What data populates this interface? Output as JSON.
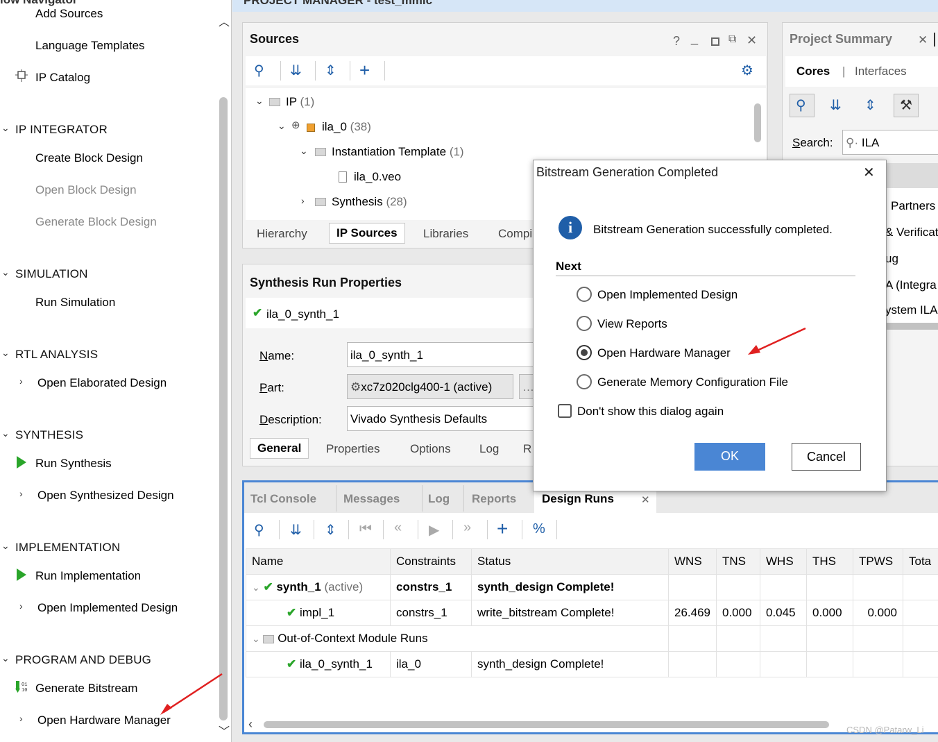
{
  "flow_nav": {
    "top_title": "low Navigator",
    "items_top": [
      "Add Sources",
      "Language Templates",
      "IP Catalog"
    ],
    "ip_integrator": {
      "header": "IP INTEGRATOR",
      "items": [
        "Create Block Design",
        "Open Block Design",
        "Generate Block Design"
      ]
    },
    "simulation": {
      "header": "SIMULATION",
      "items": [
        "Run Simulation"
      ]
    },
    "rtl": {
      "header": "RTL ANALYSIS",
      "items": [
        "Open Elaborated Design"
      ]
    },
    "synthesis": {
      "header": "SYNTHESIS",
      "items": [
        "Run Synthesis",
        "Open Synthesized Design"
      ]
    },
    "implementation": {
      "header": "IMPLEMENTATION",
      "items": [
        "Run Implementation",
        "Open Implemented Design"
      ]
    },
    "program": {
      "header": "PROGRAM AND DEBUG",
      "items": [
        "Generate Bitstream",
        "Open Hardware Manager"
      ]
    }
  },
  "topbar": {
    "title": "PROJECT MANAGER - test_mmlc"
  },
  "sources": {
    "title": "Sources",
    "window_icons": [
      "?",
      "_",
      "□",
      "⧉",
      "✕"
    ],
    "tree": [
      {
        "label": "IP",
        "count": "(1)"
      },
      {
        "label": "ila_0",
        "count": "(38)"
      },
      {
        "label": "Instantiation Template",
        "count": "(1)"
      },
      {
        "label": "ila_0.veo",
        "count": ""
      },
      {
        "label": "Synthesis",
        "count": "(28)"
      }
    ],
    "tabs": [
      "Hierarchy",
      "IP Sources",
      "Libraries",
      "Compi"
    ]
  },
  "synth_props": {
    "title": "Synthesis Run Properties",
    "run_name": "ila_0_synth_1",
    "name_label": "Name:",
    "name_value": "ila_0_synth_1",
    "part_label": "Part:",
    "part_value": "xc7z020clg400-1 (active)",
    "desc_label": "Description:",
    "desc_value": "Vivado Synthesis Defaults",
    "tabs": [
      "General",
      "Properties",
      "Options",
      "Log",
      "R"
    ]
  },
  "project_summary": {
    "title": "Project Summary",
    "tabs": [
      "Cores",
      "Interfaces"
    ],
    "search_label": "Search:",
    "search_value": "ILA",
    "list": [
      "Partners",
      "& Verificat",
      "ug",
      "A (Integra",
      "ystem ILA"
    ]
  },
  "dialog": {
    "title": "Bitstream Generation Completed",
    "message": "Bitstream Generation successfully completed.",
    "next_label": "Next",
    "options": [
      "Open Implemented Design",
      "View Reports",
      "Open Hardware Manager",
      "Generate Memory Configuration File"
    ],
    "selected_option": "Open Hardware Manager",
    "dont_show": "Don't show this dialog again",
    "ok": "OK",
    "cancel": "Cancel"
  },
  "bottom": {
    "tabs": [
      "Tcl Console",
      "Messages",
      "Log",
      "Reports",
      "Design Runs"
    ],
    "columns": [
      "Name",
      "Constraints",
      "Status",
      "WNS",
      "TNS",
      "WHS",
      "THS",
      "TPWS",
      "Tota"
    ],
    "rows": [
      {
        "name": "synth_1",
        "suffix": "(active)",
        "constraints": "constrs_1",
        "status": "synth_design Complete!",
        "wns": "",
        "tns": "",
        "whs": "",
        "ths": "",
        "tpws": ""
      },
      {
        "name": "impl_1",
        "suffix": "",
        "constraints": "constrs_1",
        "status": "write_bitstream Complete!",
        "wns": "26.469",
        "tns": "0.000",
        "whs": "0.045",
        "ths": "0.000",
        "tpws": "0.000"
      },
      {
        "name": "Out-of-Context Module Runs",
        "suffix": "",
        "constraints": "",
        "status": "",
        "wns": "",
        "tns": "",
        "whs": "",
        "ths": "",
        "tpws": ""
      },
      {
        "name": "ila_0_synth_1",
        "suffix": "",
        "constraints": "ila_0",
        "status": "synth_design Complete!",
        "wns": "",
        "tns": "",
        "whs": "",
        "ths": "",
        "tpws": ""
      }
    ]
  },
  "watermark": "CSDN @Patarw_Li",
  "colors": {
    "accent": "#4a86d4",
    "check": "#2aa52a",
    "arrow": "#e02020",
    "info": "#1f5ea8"
  }
}
